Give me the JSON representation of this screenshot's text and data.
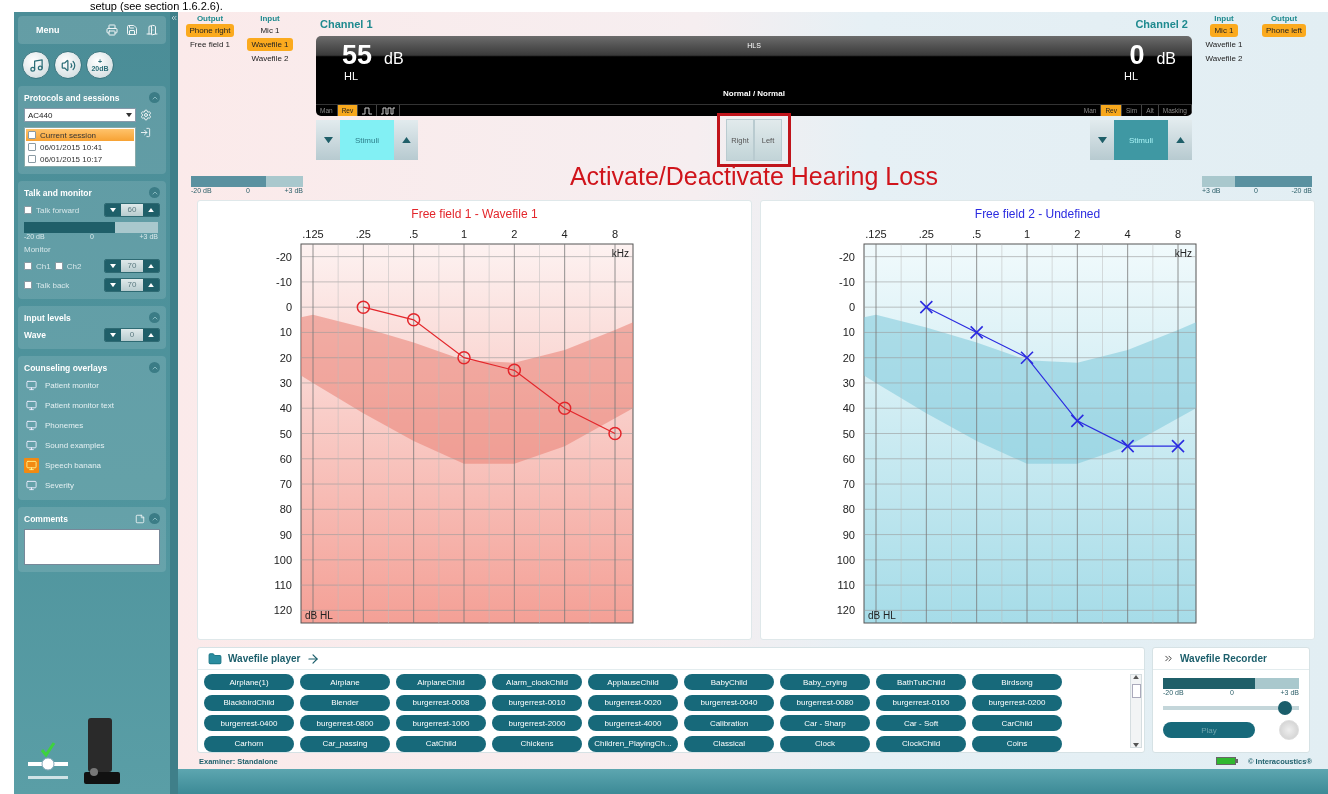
{
  "doc_text": "setup (see section 1.6.2.6).",
  "sidebar": {
    "menu": {
      "title": "Menu"
    },
    "quick_buttons": [
      {
        "kind": "tone"
      },
      {
        "kind": "speech"
      },
      {
        "kind": "boost",
        "label_top": "+",
        "label_bottom": "20dB"
      }
    ],
    "protocols": {
      "title": "Protocols and sessions",
      "protocol": "AC440",
      "sessions": [
        {
          "label": "Current session",
          "selected": true,
          "checked": false
        },
        {
          "label": "06/01/2015 10:41",
          "selected": false,
          "checked": false
        },
        {
          "label": "06/01/2015 10:17",
          "selected": false,
          "checked": false
        }
      ]
    },
    "talk": {
      "title": "Talk and monitor",
      "talk_forward": {
        "label": "Talk forward",
        "checked": false,
        "value": "60"
      },
      "meter": {
        "level": 0.68,
        "labels": [
          "-20 dB",
          "0",
          "+3 dB"
        ]
      },
      "monitor_label": "Monitor",
      "monitor": [
        {
          "label": "Ch1",
          "checked": false
        },
        {
          "label": "Ch2",
          "checked": false
        }
      ],
      "monitor_value": "70",
      "talk_back": {
        "label": "Talk back",
        "checked": false,
        "value": "70"
      }
    },
    "input_levels": {
      "title": "Input levels",
      "label": "Wave",
      "value": "0"
    },
    "overlays": {
      "title": "Counseling overlays",
      "items": [
        {
          "label": "Patient monitor",
          "selected": false
        },
        {
          "label": "Patient monitor text",
          "selected": false
        },
        {
          "label": "Phonemes",
          "selected": false
        },
        {
          "label": "Sound examples",
          "selected": false
        },
        {
          "label": "Speech banana",
          "selected": true
        },
        {
          "label": "Severity",
          "selected": false
        }
      ]
    },
    "comments": {
      "title": "Comments"
    }
  },
  "header": {
    "left_io": [
      {
        "title": "Output",
        "items": [
          {
            "label": "Phone right",
            "selected": true
          },
          {
            "label": "Free field 1",
            "selected": false
          }
        ]
      },
      {
        "title": "Input",
        "items": [
          {
            "label": "Mic 1",
            "selected": false
          },
          {
            "label": "Wavefile 1",
            "selected": true
          },
          {
            "label": "Wavefile 2",
            "selected": false
          }
        ]
      }
    ],
    "right_io": [
      {
        "title": "Input",
        "items": [
          {
            "label": "Mic 1",
            "selected": true
          },
          {
            "label": "Wavefile 1",
            "selected": false
          },
          {
            "label": "Wavefile 2",
            "selected": false
          }
        ]
      },
      {
        "title": "Output",
        "items": [
          {
            "label": "Phone left",
            "selected": true
          }
        ]
      }
    ],
    "channels": [
      {
        "title": "Channel 1",
        "value": "55",
        "unit": "dB",
        "scale": "HL",
        "modes": [
          {
            "kind": "text",
            "label": "Man",
            "selected": false
          },
          {
            "kind": "text",
            "label": "Rev",
            "selected": true
          },
          {
            "kind": "single-pulse",
            "selected": false
          },
          {
            "kind": "multi-pulse",
            "selected": false
          }
        ],
        "stimuli": {
          "label": "Stimuli",
          "on": true
        },
        "meter": {
          "level": 0.67,
          "labels": [
            "-20 dB",
            "0",
            "+3 dB"
          ]
        }
      },
      {
        "title": "Channel 2",
        "value": "0",
        "unit": "dB",
        "scale": "HL",
        "modes": [
          {
            "kind": "text",
            "label": "Man",
            "selected": false
          },
          {
            "kind": "text",
            "label": "Rev",
            "selected": true
          },
          {
            "kind": "text",
            "label": "Sim",
            "selected": false
          },
          {
            "kind": "text",
            "label": "Alt",
            "selected": false
          },
          {
            "kind": "text",
            "label": "Masking",
            "selected": false
          }
        ],
        "stimuli": {
          "label": "Stimuli",
          "on": false
        },
        "meter": {
          "level": 0.7,
          "labels": [
            "+3 dB",
            "0",
            "-20 dB"
          ]
        }
      }
    ],
    "display_center": {
      "title": "HLS",
      "status": "Normal / Normal"
    },
    "ear_buttons": [
      {
        "label": "Right"
      },
      {
        "label": "Left"
      }
    ]
  },
  "annotation": "Activate/Deactivate Hearing Loss",
  "audiograms": [
    {
      "chart_data": {
        "type": "line",
        "title": "Free field 1 - Wavefile 1",
        "grid": true,
        "xlabel": "kHz",
        "ylabel": "dB HL",
        "categories": [
          ".125",
          ".25",
          ".5",
          "1",
          "2",
          "4",
          "8"
        ],
        "ylim": [
          125,
          -25
        ],
        "yticks": [
          -20,
          -10,
          0,
          10,
          20,
          30,
          40,
          50,
          60,
          70,
          80,
          90,
          100,
          110,
          120
        ],
        "series": [
          {
            "color": "#e3262b",
            "marker": "circle",
            "values": [
              null,
              0,
              5,
              20,
              25,
              40,
              50
            ]
          }
        ]
      }
    },
    {
      "chart_data": {
        "type": "line",
        "title": "Free field 2 - Undefined",
        "grid": true,
        "xlabel": "kHz",
        "ylabel": "dB HL",
        "categories": [
          ".125",
          ".25",
          ".5",
          "1",
          "2",
          "4",
          "8"
        ],
        "ylim": [
          125,
          -25
        ],
        "yticks": [
          -20,
          -10,
          0,
          10,
          20,
          30,
          40,
          50,
          60,
          70,
          80,
          90,
          100,
          110,
          120
        ],
        "series": [
          {
            "color": "#2b2be0",
            "marker": "cross",
            "values": [
              null,
              0,
              10,
              20,
              45,
              55,
              55
            ]
          }
        ]
      }
    }
  ],
  "wavefile_player": {
    "title": "Wavefile player",
    "files": [
      "Airplane(1)",
      "Airplane",
      "AirplaneChild",
      "Alarm_clockChild",
      "ApplauseChild",
      "BabyChild",
      "Baby_crying",
      "BathTubChild",
      "Birdsong",
      "BlackbirdChild",
      "Blender",
      "burgerrest-0008",
      "burgerrest-0010",
      "burgerrest-0020",
      "burgerrest-0040",
      "burgerrest-0080",
      "burgerrest-0100",
      "burgerrest-0200",
      "burgerrest-0400",
      "burgerrest-0800",
      "burgerrest-1000",
      "burgerrest-2000",
      "burgerrest-4000",
      "Calibration",
      "Car - Sharp",
      "Car - Soft",
      "CarChild",
      "Carhorn",
      "Car_passing",
      "CatChild",
      "Chickens",
      "Children_PlayingCh...",
      "Classical",
      "Clock",
      "ClockChild",
      "Coins"
    ]
  },
  "recorder": {
    "title": "Wavefile Recorder",
    "meter": {
      "level": 0.68,
      "labels": [
        "-20 dB",
        "0",
        "+3 dB"
      ]
    },
    "slider": {
      "level": 0.9
    },
    "play": "Play"
  },
  "status_bar": {
    "examiner": "Examiner: Standalone",
    "copyright": "© Interacoustics®"
  }
}
